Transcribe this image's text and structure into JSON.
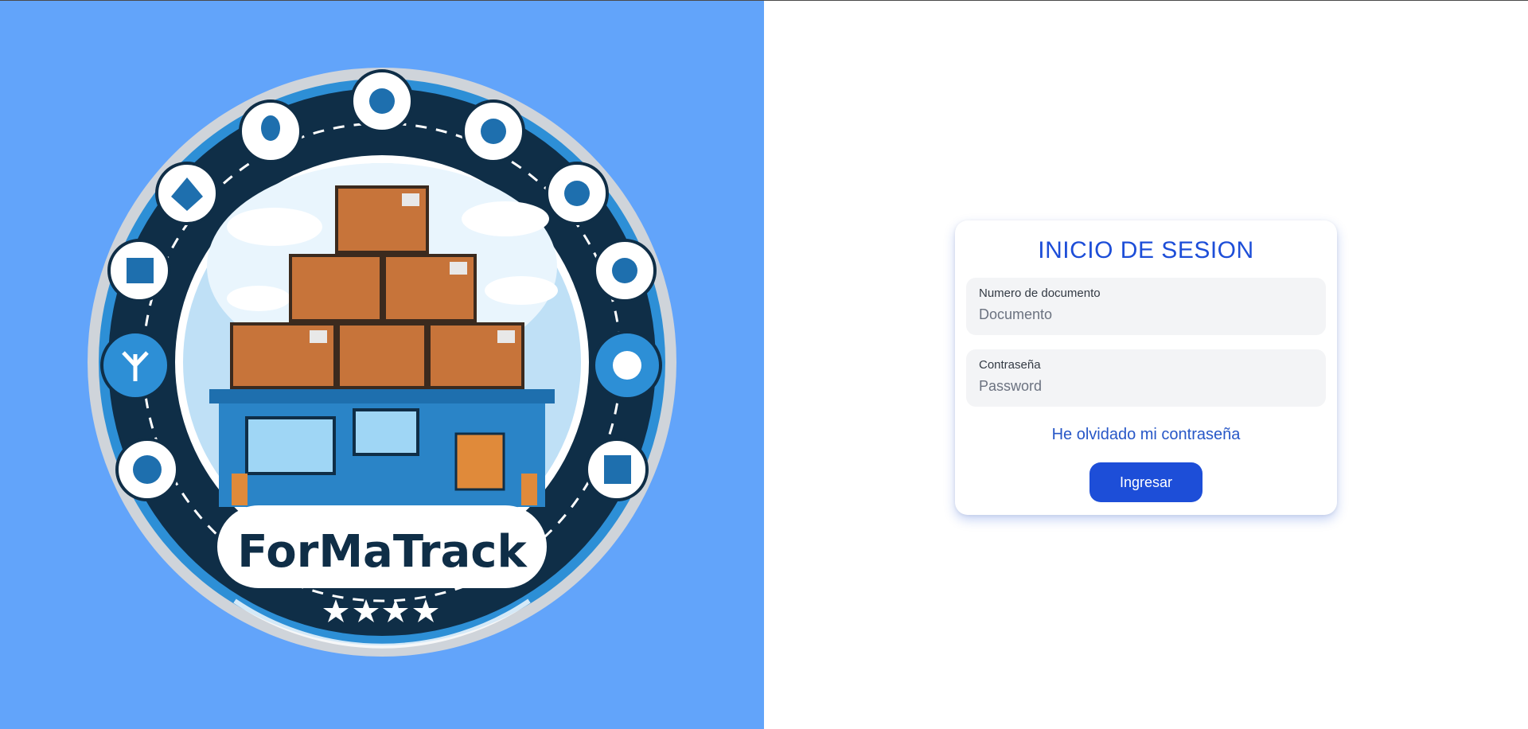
{
  "brand": {
    "logo_text": "ForMaTrack",
    "background_color": "#62a4fa",
    "logo_icons": [
      "diamond-icon",
      "lightbulb-icon",
      "gear-icon",
      "machine-icon",
      "gear-icon",
      "gear-icon",
      "gear-icon",
      "grid-icon",
      "globe-icon",
      "leaf-icon",
      "calendar-icon"
    ],
    "stars": 4
  },
  "login": {
    "title": "INICIO DE SESION",
    "document_field": {
      "label": "Numero de documento",
      "placeholder": "Documento",
      "value": ""
    },
    "password_field": {
      "label": "Contraseña",
      "placeholder": "Password",
      "value": ""
    },
    "forgot_password_link": "He olvidado mi contraseña",
    "submit_label": "Ingresar",
    "accent_color": "#1d4ed8"
  }
}
